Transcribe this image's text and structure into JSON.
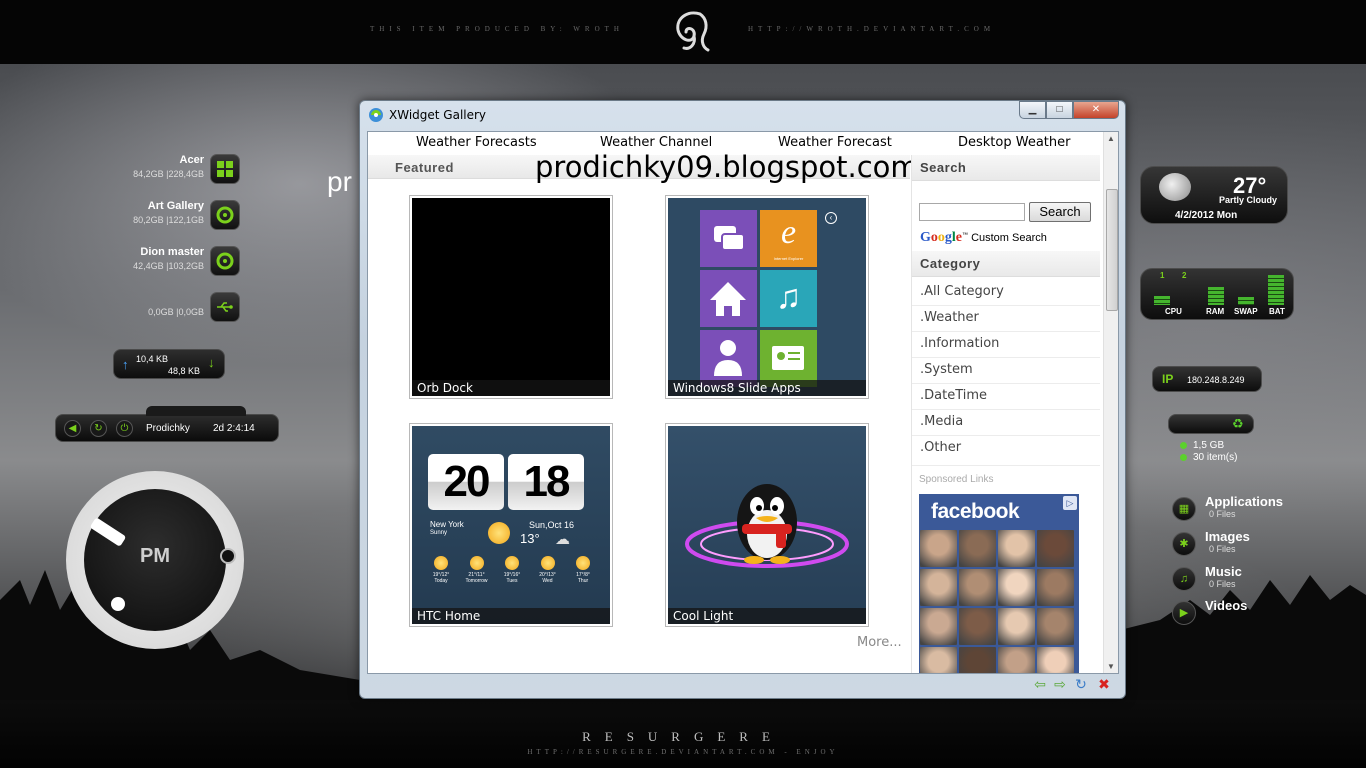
{
  "desktop": {
    "top_credit_left": "THIS ITEM PRODUCED BY: WROTH",
    "top_credit_right": "HTTP://WROTH.DEVIANTART.COM",
    "bottom_title": "RESURGERE",
    "bottom_sub": "HTTP://RESURGERE.DEVIANTART.COM - ENJOY",
    "bg_title_fragment": "pr"
  },
  "drives": [
    {
      "name": "Acer",
      "size": "84,2GB |228,4GB",
      "icon": "windows-icon"
    },
    {
      "name": "Art Gallery",
      "size": "80,2GB |122,1GB",
      "icon": "drive-icon"
    },
    {
      "name": "Dion master",
      "size": "42,4GB |103,2GB",
      "icon": "drive-icon"
    },
    {
      "name": "",
      "size": "0,0GB |0,0GB",
      "icon": "usb-icon"
    }
  ],
  "network": {
    "up": "10,4 KB",
    "down": "48,8 KB"
  },
  "userbar": {
    "name": "Prodichky",
    "uptime": "2d 2:4:14"
  },
  "clock": {
    "meridiem": "PM"
  },
  "weather": {
    "temp": "27°",
    "condition": "Partly Cloudy",
    "date": "4/2/2012 Mon"
  },
  "sysmon": {
    "labels": [
      "CPU",
      "RAM",
      "SWAP",
      "BAT"
    ],
    "counters": [
      "1",
      "2"
    ],
    "levels": [
      0.3,
      0.6,
      0.25,
      1.0
    ],
    "bar_color": "#45b52e"
  },
  "ip": {
    "label": "IP",
    "value": "180.248.8.249"
  },
  "recycle": {
    "size": "1,5 GB",
    "items": "30 item(s)"
  },
  "places": [
    {
      "name": "Applications",
      "count": "0 Files",
      "icon": "apps-icon"
    },
    {
      "name": "Images",
      "count": "0 Files",
      "icon": "images-icon"
    },
    {
      "name": "Music",
      "count": "0 Files",
      "icon": "music-icon"
    },
    {
      "name": "Videos",
      "count": "0 Files",
      "icon": "play-icon"
    }
  ],
  "window": {
    "title": "XWidget Gallery",
    "nav": [
      "Weather Forecasts",
      "Weather Channel",
      "Weather Forecast",
      "Desktop Weather"
    ],
    "featured_label": "Featured",
    "watermark": "prodichky09.blogspot.com",
    "tiles": [
      {
        "caption": "Orb Dock"
      },
      {
        "caption": "Windows8 Slide Apps"
      },
      {
        "caption": "HTC Home",
        "hour": "20",
        "minute": "18",
        "city": "New York",
        "cond": "Sunny",
        "date": "Sun,Oct 16",
        "temp": "13°",
        "forecast": [
          {
            "d": "Today",
            "t": "19°/12°"
          },
          {
            "d": "Tomorrow",
            "t": "21°/11°"
          },
          {
            "d": "Tues",
            "t": "19°/16°"
          },
          {
            "d": "Wed",
            "t": "20°/13°"
          },
          {
            "d": "Thur",
            "t": "17°/8°"
          }
        ]
      },
      {
        "caption": "Cool Light"
      }
    ],
    "more_label": "More...",
    "search_head": "Search",
    "search_placeholder": "",
    "search_button": "Search",
    "custom_search": "Custom Search",
    "category_head": "Category",
    "categories": [
      ".All Category",
      ".Weather",
      ".Information",
      ".System",
      ".DateTime",
      ".Media",
      ".Other"
    ],
    "sponsored": "Sponsored Links",
    "ad_brand": "facebook",
    "ad_tile_label": "Internet Explorer"
  },
  "colors": {
    "accent_green": "#7bd11c",
    "fb_blue": "#3b5998"
  }
}
